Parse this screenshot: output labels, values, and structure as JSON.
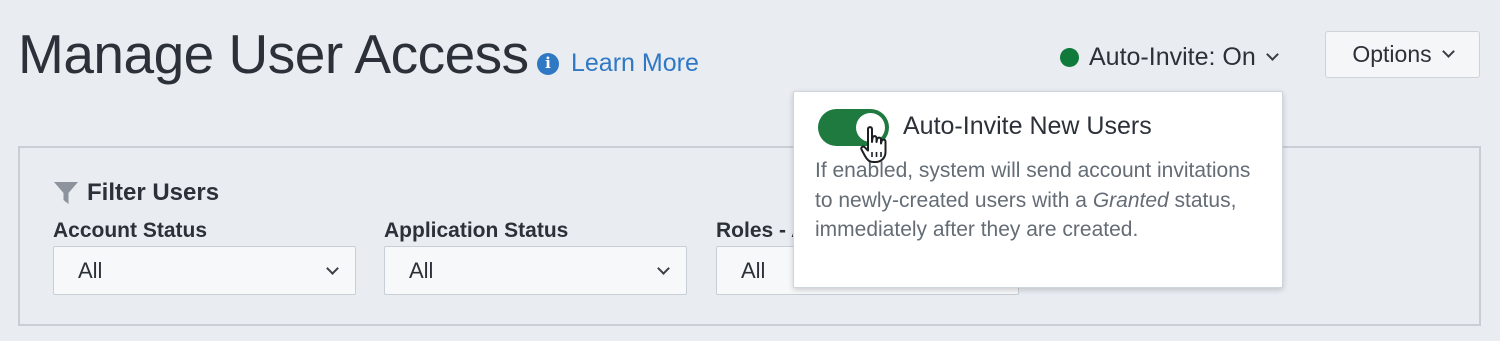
{
  "header": {
    "title": "Manage User Access",
    "learn_more": {
      "label": "Learn More",
      "icon": "info-icon"
    },
    "auto_invite": {
      "label": "Auto-Invite: On",
      "status": "On",
      "status_color": "#0f7a3b",
      "icon": "chevron-down-icon"
    },
    "options": {
      "label": "Options",
      "icon": "chevron-down-icon"
    }
  },
  "filter": {
    "heading": "Filter Users",
    "icon": "funnel-icon",
    "fields": [
      {
        "label": "Account Status",
        "value": "All"
      },
      {
        "label": "Application Status",
        "value": "All"
      },
      {
        "label": "Roles - A",
        "value": "All"
      }
    ]
  },
  "popover": {
    "toggle": {
      "label": "Auto-Invite New Users",
      "state": "on",
      "color": "#1f7a40"
    },
    "description": {
      "part1": "If enabled, system will send account invitations to newly-created users with a",
      "emphasis": "Granted",
      "part2": "status, immediately after they are created."
    }
  },
  "colors": {
    "background": "#e9edf2",
    "link": "#2f78c4",
    "text": "#2c3139",
    "muted_text": "#646c76"
  }
}
